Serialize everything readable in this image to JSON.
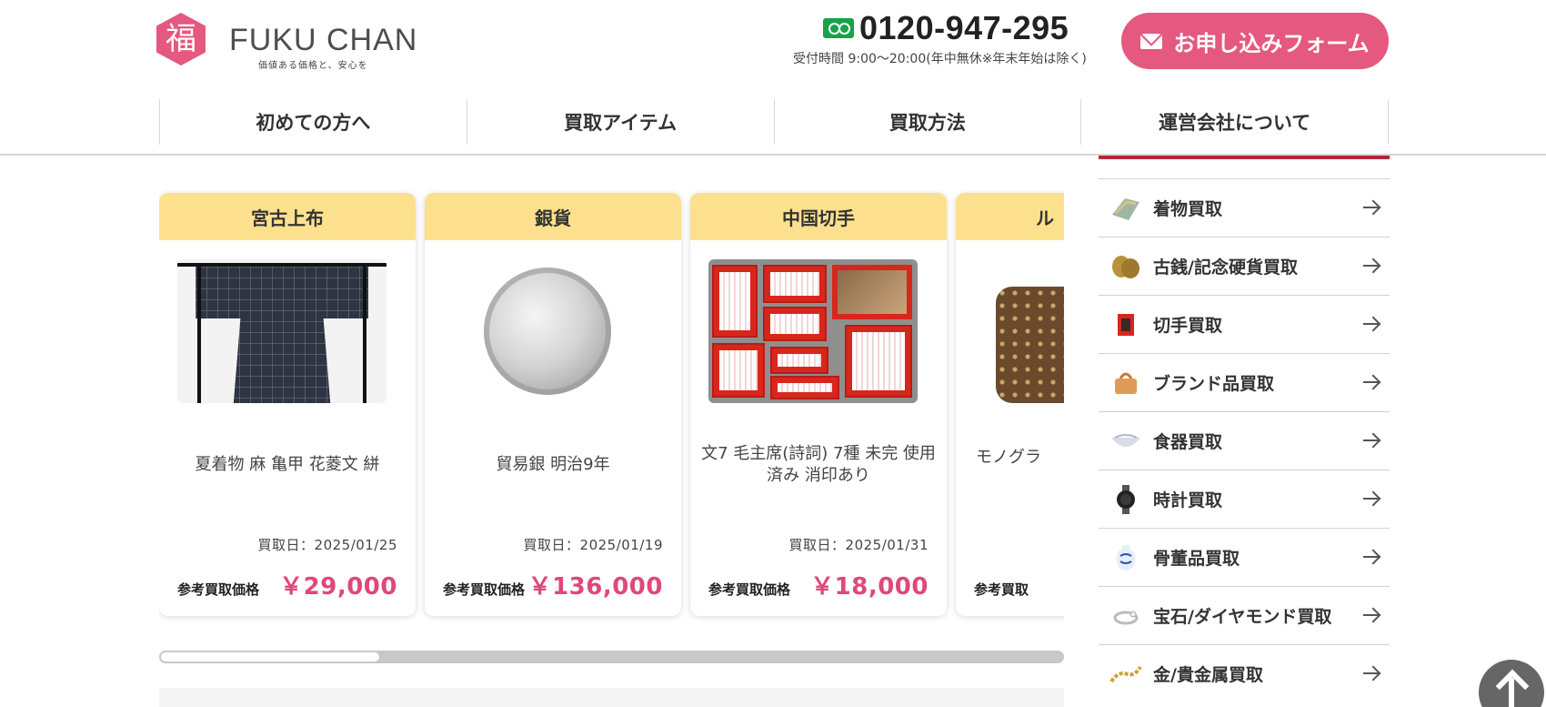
{
  "header": {
    "logo_kanji": "福",
    "brand": "FUKU CHAN",
    "tagline": "価値ある価格と、安心を",
    "phone_number": "0120-947-295",
    "hours": "受付時間 9:00～20:00(年中無休※年末年始は除く)",
    "apply_button": "お申し込みフォーム"
  },
  "nav": [
    {
      "label": "初めての方へ"
    },
    {
      "label": "買取アイテム"
    },
    {
      "label": "買取方法"
    },
    {
      "label": "運営会社について"
    }
  ],
  "cards": [
    {
      "category": "宮古上布",
      "title": "夏着物 麻 亀甲 花菱文 絣",
      "date": "買取日：2025/01/25",
      "price_label": "参考買取価格",
      "price": "￥29,000",
      "photo": "kimono"
    },
    {
      "category": "銀貨",
      "title": "貿易銀 明治9年",
      "date": "買取日：2025/01/19",
      "price_label": "参考買取価格",
      "price": "￥136,000",
      "photo": "silver-coin"
    },
    {
      "category": "中国切手",
      "title": "文7 毛主席(詩詞) 7種 未完 使用済み 消印あり",
      "date": "買取日：2025/01/31",
      "price_label": "参考買取価格",
      "price": "￥18,000",
      "photo": "stamps"
    },
    {
      "category": "ル",
      "title": "モノグラ",
      "date": "",
      "price_label": "参考買取",
      "price": "",
      "photo": "handbag"
    }
  ],
  "sidebar": [
    {
      "label": "着物買取",
      "icon": "kimono-icon"
    },
    {
      "label": "古銭/記念硬貨買取",
      "icon": "coin-icon"
    },
    {
      "label": "切手買取",
      "icon": "stamp-icon"
    },
    {
      "label": "ブランド品買取",
      "icon": "handbag-icon"
    },
    {
      "label": "食器買取",
      "icon": "tableware-icon"
    },
    {
      "label": "時計買取",
      "icon": "watch-icon"
    },
    {
      "label": "骨董品買取",
      "icon": "antique-vase-icon"
    },
    {
      "label": "宝石/ダイヤモンド買取",
      "icon": "ring-icon"
    },
    {
      "label": "金/貴金属買取",
      "icon": "gold-chain-icon"
    }
  ],
  "colors": {
    "brand_pink": "#e5587f",
    "price_pink": "#e0477a",
    "card_header_yellow": "#fde08e",
    "sidebar_accent": "#b3273a",
    "freedial_green": "#19a24a"
  },
  "carousel": {
    "scroll_position": 0.0
  }
}
